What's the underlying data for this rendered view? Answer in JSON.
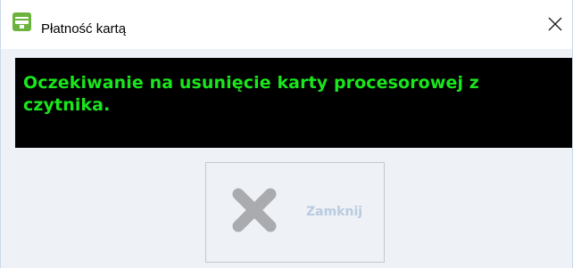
{
  "window": {
    "title": "Płatność kartą",
    "app_icon": "card-terminal-icon",
    "close_icon": "close-icon"
  },
  "message": {
    "text": "Oczekiwanie na usunięcie karty procesorowej z czytnika.",
    "color": "#19e61c",
    "background": "#000000"
  },
  "actions": {
    "close_label": "Zamknij",
    "close_icon": "x-icon",
    "enabled": false
  },
  "colors": {
    "app_icon_green": "#6cb33e",
    "disabled_label": "#b9cbe0",
    "dialog_background": "#eef1f6"
  }
}
